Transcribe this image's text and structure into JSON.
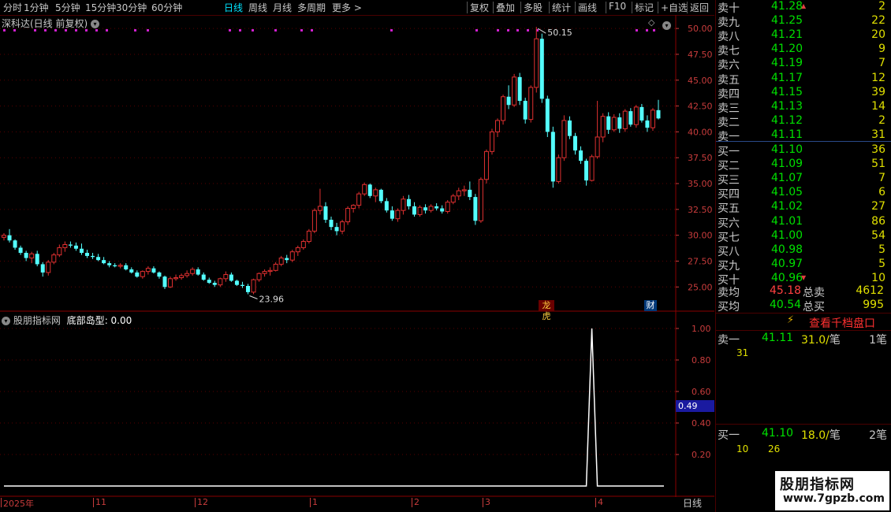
{
  "toolbar": {
    "left_items": [
      "分时",
      "1分钟",
      "5分钟",
      "15分钟",
      "30分钟",
      "60分钟",
      "日线",
      "周线",
      "月线",
      "多周期",
      "更多 >"
    ],
    "active": "日线",
    "right_items": [
      "复权",
      "叠加",
      "多股",
      "统计",
      "画线",
      "F10",
      "标记",
      "+自选",
      "返回"
    ]
  },
  "chart_header": {
    "stock": "深科达(日线 前复权)"
  },
  "price_axis": {
    "labels": [
      "50.00",
      "47.50",
      "45.00",
      "42.50",
      "40.00",
      "37.50",
      "35.00",
      "32.50",
      "30.00",
      "27.50",
      "25.00"
    ],
    "high_marker": "50.15",
    "low_marker": "23.96",
    "badge_left": "龙虎",
    "badge_right": "财"
  },
  "indicator": {
    "title": "股朋指标网",
    "name": "底部岛型",
    "value": "0.00",
    "labels": [
      "1.00",
      "0.80",
      "0.60",
      "0.40",
      "0.20"
    ],
    "current": "0.49"
  },
  "date_axis": {
    "labels": [
      "2025年",
      "11",
      "12",
      "1",
      "2",
      "3",
      "4"
    ],
    "period": "日线"
  },
  "orderbook": {
    "sells": [
      {
        "label": "卖十",
        "price": "41.28",
        "vol": "2"
      },
      {
        "label": "卖九",
        "price": "41.25",
        "vol": "22"
      },
      {
        "label": "卖八",
        "price": "41.21",
        "vol": "20"
      },
      {
        "label": "卖七",
        "price": "41.20",
        "vol": "9"
      },
      {
        "label": "卖六",
        "price": "41.19",
        "vol": "7"
      },
      {
        "label": "卖五",
        "price": "41.17",
        "vol": "12"
      },
      {
        "label": "卖四",
        "price": "41.15",
        "vol": "39"
      },
      {
        "label": "卖三",
        "price": "41.13",
        "vol": "14"
      },
      {
        "label": "卖二",
        "price": "41.12",
        "vol": "2"
      },
      {
        "label": "卖一",
        "price": "41.11",
        "vol": "31"
      }
    ],
    "buys": [
      {
        "label": "买一",
        "price": "41.10",
        "vol": "36"
      },
      {
        "label": "买二",
        "price": "41.09",
        "vol": "51"
      },
      {
        "label": "买三",
        "price": "41.07",
        "vol": "7"
      },
      {
        "label": "买四",
        "price": "41.05",
        "vol": "6"
      },
      {
        "label": "买五",
        "price": "41.02",
        "vol": "27"
      },
      {
        "label": "买六",
        "price": "41.01",
        "vol": "86"
      },
      {
        "label": "买七",
        "price": "41.00",
        "vol": "54"
      },
      {
        "label": "买八",
        "price": "40.98",
        "vol": "5"
      },
      {
        "label": "买九",
        "price": "40.97",
        "vol": "5"
      },
      {
        "label": "买十",
        "price": "40.96",
        "vol": "10"
      }
    ],
    "avg_sell_label": "卖均",
    "avg_sell": "45.18",
    "total_sell_label": "总卖",
    "total_sell": "4612",
    "avg_buy_label": "买均",
    "avg_buy": "40.54",
    "total_buy_label": "总买",
    "total_buy": "995"
  },
  "depth": {
    "button": "查看千档盘口",
    "sell_label": "卖一",
    "sell_price": "41.11",
    "sell_qty": "31.0/",
    "sell_unit": "笔",
    "sell_count": "1笔",
    "sell_detail": "31",
    "buy_label": "买一",
    "buy_price": "41.10",
    "buy_qty": "18.0/",
    "buy_unit": "笔",
    "buy_count": "2笔",
    "buy_detail_1": "10",
    "buy_detail_2": "26"
  },
  "watermark": {
    "name": "股朋指标网",
    "url": "www.7gpzb.com"
  },
  "chart_data": {
    "type": "candlestick",
    "price_range": [
      23.5,
      51.0
    ],
    "indicator_range": [
      0,
      1.1
    ],
    "up_color": "#e03030",
    "down_color": "#54ffff",
    "candles": [
      [
        29.8,
        30.2,
        29.5,
        30.0
      ],
      [
        30.0,
        30.6,
        29.3,
        29.5
      ],
      [
        29.5,
        29.6,
        28.6,
        28.8
      ],
      [
        28.8,
        29.0,
        28.1,
        28.3
      ],
      [
        28.3,
        28.5,
        27.5,
        27.8
      ],
      [
        27.8,
        28.4,
        27.3,
        28.2
      ],
      [
        28.2,
        28.5,
        27.0,
        27.2
      ],
      [
        27.2,
        27.4,
        26.0,
        26.4
      ],
      [
        26.4,
        27.6,
        26.1,
        27.4
      ],
      [
        27.4,
        28.3,
        27.2,
        28.1
      ],
      [
        28.1,
        29.1,
        27.9,
        28.8
      ],
      [
        28.8,
        29.4,
        28.4,
        29.1
      ],
      [
        29.1,
        29.4,
        28.8,
        29.0
      ],
      [
        29.0,
        29.3,
        28.5,
        28.7
      ],
      [
        28.7,
        29.2,
        28.1,
        28.3
      ],
      [
        28.3,
        28.6,
        27.8,
        28.0
      ],
      [
        28.0,
        28.3,
        27.7,
        27.9
      ],
      [
        27.9,
        28.2,
        27.5,
        27.6
      ],
      [
        27.6,
        27.9,
        27.2,
        27.3
      ],
      [
        27.3,
        27.5,
        26.9,
        27.1
      ],
      [
        27.1,
        27.3,
        26.9,
        27.0
      ],
      [
        27.0,
        27.3,
        26.8,
        27.1
      ],
      [
        27.1,
        27.3,
        26.6,
        26.7
      ],
      [
        26.7,
        26.9,
        26.3,
        26.4
      ],
      [
        26.4,
        26.6,
        25.9,
        26.0
      ],
      [
        26.0,
        26.6,
        25.8,
        26.5
      ],
      [
        26.5,
        27.0,
        26.2,
        26.8
      ],
      [
        26.8,
        27.0,
        26.3,
        26.4
      ],
      [
        26.4,
        26.5,
        25.8,
        26.0
      ],
      [
        26.0,
        26.1,
        24.8,
        25.0
      ],
      [
        25.0,
        26.0,
        24.9,
        25.8
      ],
      [
        25.8,
        26.2,
        25.6,
        25.9
      ],
      [
        25.9,
        26.3,
        25.7,
        26.1
      ],
      [
        26.1,
        26.6,
        25.9,
        26.3
      ],
      [
        26.3,
        26.9,
        26.1,
        26.7
      ],
      [
        26.7,
        26.9,
        26.1,
        26.2
      ],
      [
        26.2,
        26.4,
        25.6,
        25.7
      ],
      [
        25.7,
        25.9,
        25.3,
        25.4
      ],
      [
        25.4,
        25.6,
        25.0,
        25.2
      ],
      [
        25.2,
        25.9,
        25.0,
        25.8
      ],
      [
        25.8,
        26.5,
        25.5,
        26.2
      ],
      [
        26.2,
        26.4,
        25.5,
        25.6
      ],
      [
        25.6,
        25.7,
        25.1,
        25.2
      ],
      [
        25.2,
        25.5,
        24.9,
        25.1
      ],
      [
        25.1,
        25.3,
        24.3,
        24.5
      ],
      [
        24.5,
        25.8,
        24.3,
        25.7
      ],
      [
        25.7,
        26.4,
        25.5,
        26.3
      ],
      [
        26.3,
        26.7,
        26.0,
        26.5
      ],
      [
        26.5,
        26.9,
        26.1,
        26.6
      ],
      [
        26.6,
        27.4,
        26.5,
        27.2
      ],
      [
        27.2,
        28.0,
        27.0,
        27.8
      ],
      [
        27.8,
        28.1,
        27.3,
        27.6
      ],
      [
        27.6,
        28.6,
        27.4,
        28.4
      ],
      [
        28.4,
        29.0,
        28.0,
        28.8
      ],
      [
        28.8,
        29.6,
        28.6,
        29.4
      ],
      [
        29.4,
        30.6,
        29.2,
        30.4
      ],
      [
        30.4,
        32.6,
        30.2,
        32.4
      ],
      [
        32.4,
        34.5,
        32.0,
        32.8
      ],
      [
        32.8,
        33.2,
        31.2,
        31.5
      ],
      [
        31.5,
        31.8,
        30.5,
        30.8
      ],
      [
        30.8,
        31.2,
        30.0,
        30.4
      ],
      [
        30.4,
        31.5,
        30.1,
        31.3
      ],
      [
        31.3,
        32.8,
        31.0,
        32.6
      ],
      [
        32.6,
        33.0,
        32.2,
        32.9
      ],
      [
        32.9,
        34.2,
        32.6,
        34.0
      ],
      [
        34.0,
        35.1,
        33.8,
        34.9
      ],
      [
        34.9,
        35.0,
        33.6,
        33.8
      ],
      [
        33.8,
        34.6,
        33.2,
        34.4
      ],
      [
        34.4,
        34.5,
        33.1,
        33.3
      ],
      [
        33.3,
        33.6,
        32.2,
        32.4
      ],
      [
        32.4,
        32.8,
        31.4,
        31.6
      ],
      [
        31.6,
        32.6,
        31.3,
        32.4
      ],
      [
        32.4,
        33.8,
        32.0,
        33.5
      ],
      [
        33.5,
        33.9,
        32.5,
        32.8
      ],
      [
        32.8,
        33.2,
        31.8,
        32.0
      ],
      [
        32.0,
        32.9,
        31.8,
        32.7
      ],
      [
        32.7,
        33.0,
        32.1,
        32.4
      ],
      [
        32.4,
        33.0,
        32.2,
        32.8
      ],
      [
        32.8,
        33.1,
        32.4,
        32.6
      ],
      [
        32.6,
        32.9,
        32.1,
        32.3
      ],
      [
        32.3,
        33.4,
        32.1,
        33.2
      ],
      [
        33.2,
        34.0,
        33.0,
        33.8
      ],
      [
        33.8,
        34.6,
        33.4,
        34.3
      ],
      [
        34.3,
        34.8,
        33.8,
        34.4
      ],
      [
        34.4,
        35.2,
        33.4,
        33.7
      ],
      [
        33.7,
        34.0,
        31.0,
        31.4
      ],
      [
        31.4,
        35.6,
        31.2,
        35.4
      ],
      [
        35.4,
        38.3,
        35.0,
        38.1
      ],
      [
        38.1,
        40.3,
        37.8,
        40.0
      ],
      [
        40.0,
        41.3,
        39.5,
        41.1
      ],
      [
        41.1,
        43.6,
        40.7,
        43.4
      ],
      [
        43.4,
        44.5,
        42.2,
        42.6
      ],
      [
        42.6,
        45.6,
        42.4,
        45.3
      ],
      [
        45.3,
        45.7,
        42.6,
        43.0
      ],
      [
        43.0,
        43.3,
        40.8,
        41.2
      ],
      [
        41.2,
        44.5,
        40.9,
        44.3
      ],
      [
        44.3,
        50.15,
        43.8,
        49.0
      ],
      [
        49.0,
        49.5,
        42.8,
        43.2
      ],
      [
        43.2,
        43.5,
        39.5,
        40.0
      ],
      [
        40.0,
        40.5,
        34.6,
        35.2
      ],
      [
        35.2,
        37.8,
        35.0,
        37.5
      ],
      [
        37.5,
        41.6,
        37.2,
        41.1
      ],
      [
        41.1,
        41.5,
        39.3,
        39.6
      ],
      [
        39.6,
        39.9,
        37.8,
        38.2
      ],
      [
        38.2,
        38.6,
        36.9,
        37.2
      ],
      [
        37.2,
        37.4,
        34.8,
        35.3
      ],
      [
        35.3,
        37.8,
        35.2,
        37.6
      ],
      [
        37.6,
        43.0,
        37.4,
        39.5
      ],
      [
        39.5,
        41.8,
        39.0,
        41.5
      ],
      [
        41.5,
        41.9,
        39.8,
        40.2
      ],
      [
        40.2,
        41.7,
        40.0,
        41.4
      ],
      [
        41.4,
        41.8,
        39.9,
        40.3
      ],
      [
        40.3,
        42.2,
        40.0,
        42.0
      ],
      [
        42.0,
        42.3,
        40.5,
        40.7
      ],
      [
        40.7,
        42.6,
        40.4,
        42.4
      ],
      [
        42.4,
        42.7,
        40.9,
        41.1
      ],
      [
        41.1,
        41.6,
        40.0,
        40.4
      ],
      [
        40.4,
        42.3,
        40.1,
        42.1
      ],
      [
        42.1,
        43.1,
        41.2,
        41.3
      ]
    ],
    "indicator_values": [
      0,
      0,
      0,
      0,
      0,
      0,
      0,
      0,
      0,
      0,
      0,
      0,
      0,
      0,
      0,
      0,
      0,
      0,
      0,
      0,
      0,
      0,
      0,
      0,
      0,
      0,
      0,
      0,
      0,
      0,
      0,
      0,
      0,
      0,
      0,
      0,
      0,
      0,
      0,
      0,
      0,
      0,
      0,
      0,
      0,
      0,
      0,
      0,
      0,
      0,
      0,
      0,
      0,
      0,
      0,
      0,
      0,
      0,
      0,
      0,
      0,
      0,
      0,
      0,
      0,
      0,
      0,
      0,
      0,
      0,
      0,
      0,
      0,
      0,
      0,
      0,
      0,
      0,
      0,
      0,
      0,
      0,
      0,
      0,
      0,
      0,
      0,
      0,
      0,
      0,
      0,
      0,
      0,
      0,
      0,
      0,
      0,
      0,
      0,
      0,
      0,
      0,
      0,
      0,
      0,
      0,
      1,
      0,
      0,
      0,
      0,
      0,
      0,
      0,
      0,
      0,
      0,
      0,
      0,
      0
    ]
  }
}
